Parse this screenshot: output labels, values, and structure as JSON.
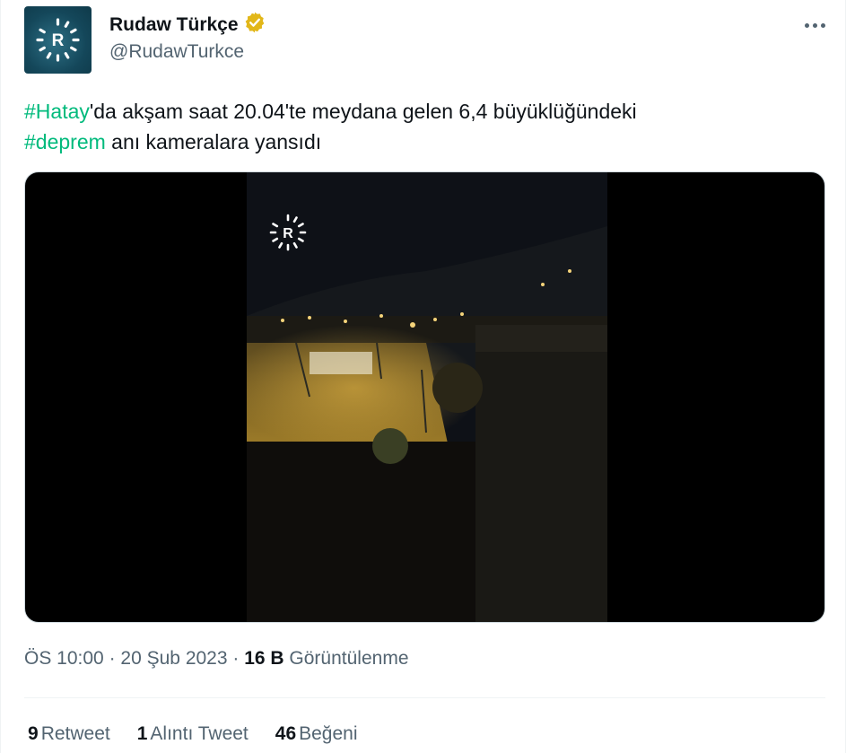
{
  "author": {
    "display_name": "Rudaw Türkçe",
    "handle": "@RudawTurkce",
    "avatar_logo_letter": "R",
    "avatar_color": "#14475a",
    "verified_badge_color": "#e2b719"
  },
  "tweet": {
    "hashtag1": "#Hatay",
    "text_part1": "'da akşam saat 20.04'te meydana gelen 6,4 büyüklüğündeki",
    "hashtag2": "#deprem",
    "text_part2": " anı kameralara yansıdı",
    "hashtag_color": "#00ba7c"
  },
  "media": {
    "type": "video",
    "watermark_letter": "R"
  },
  "meta": {
    "time": "ÖS 10:00",
    "separator": "·",
    "date": "20 Şub 2023",
    "views_count": "16 B",
    "views_label": "Görüntülenme"
  },
  "stats": {
    "retweets_count": "9",
    "retweets_label": "Retweet",
    "quotes_count": "1",
    "quotes_label": "Alıntı Tweet",
    "likes_count": "46",
    "likes_label": "Beğeni"
  },
  "more_icon": "more-horizontal-icon"
}
